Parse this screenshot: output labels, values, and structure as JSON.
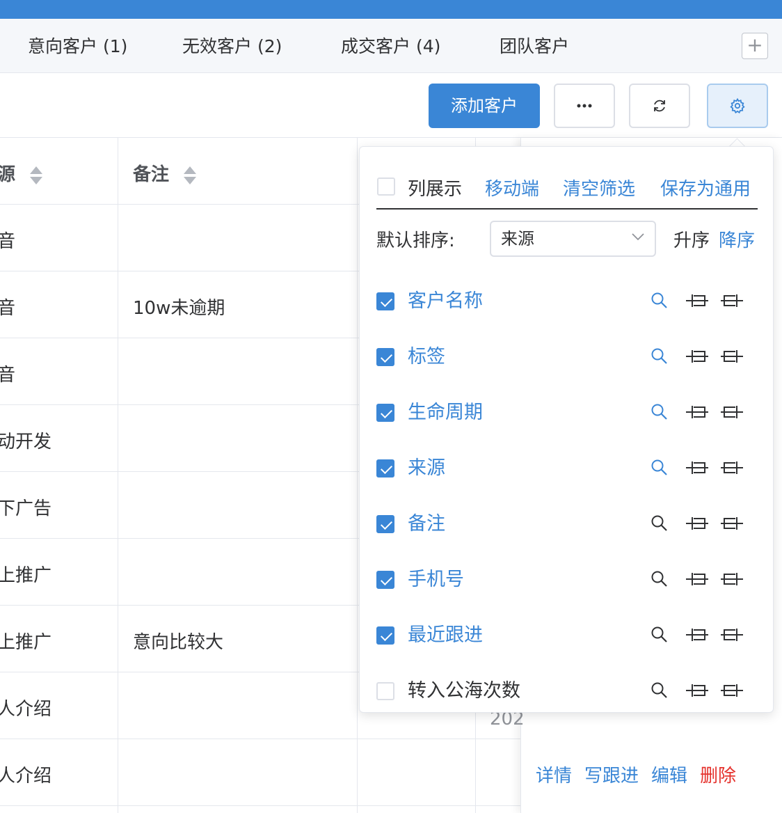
{
  "tabs": {
    "items": [
      {
        "label": "意向客户 (1)"
      },
      {
        "label": "无效客户 (2)"
      },
      {
        "label": "成交客户 (4)"
      },
      {
        "label": "团队客户"
      }
    ],
    "add_label": "+"
  },
  "toolbar": {
    "add_customer_label": "添加客户",
    "more_icon": "ellipsis-icon",
    "refresh_icon": "refresh-icon",
    "settings_icon": "gear-icon"
  },
  "table": {
    "headers": {
      "source": "源",
      "remark": "备注"
    },
    "rows": [
      {
        "source": "音",
        "remark": ""
      },
      {
        "source": "音",
        "remark": "10w未逾期"
      },
      {
        "source": "音",
        "remark": ""
      },
      {
        "source": "动开发",
        "remark": ""
      },
      {
        "source": "下广告",
        "remark": ""
      },
      {
        "source": "上推广",
        "remark": ""
      },
      {
        "source": "上推广",
        "remark": "意向比较大"
      },
      {
        "source": "人介绍",
        "remark": ""
      },
      {
        "source": "人介绍",
        "remark": ""
      }
    ],
    "date_fragment": "202",
    "row_actions": {
      "detail": "详情",
      "follow": "写跟进",
      "edit": "编辑",
      "delete": "删除"
    }
  },
  "popover": {
    "column_display_label": "列展示",
    "mobile_label": "移动端",
    "clear_filter_label": "清空筛选",
    "save_common_label": "保存为通用",
    "default_sort_label": "默认排序:",
    "sort_field_value": "来源",
    "asc_label": "升序",
    "desc_label": "降序",
    "columns": [
      {
        "label": "客户名称",
        "checked": true
      },
      {
        "label": "标签",
        "checked": true
      },
      {
        "label": "生命周期",
        "checked": true
      },
      {
        "label": "来源",
        "checked": true
      },
      {
        "label": "备注",
        "checked": true
      },
      {
        "label": "手机号",
        "checked": true
      },
      {
        "label": "最近跟进",
        "checked": true
      },
      {
        "label": "转入公海次数",
        "checked": false
      }
    ]
  },
  "colors": {
    "accent": "#3a86d6",
    "danger": "#e5322d",
    "border": "#e4e7ed"
  }
}
